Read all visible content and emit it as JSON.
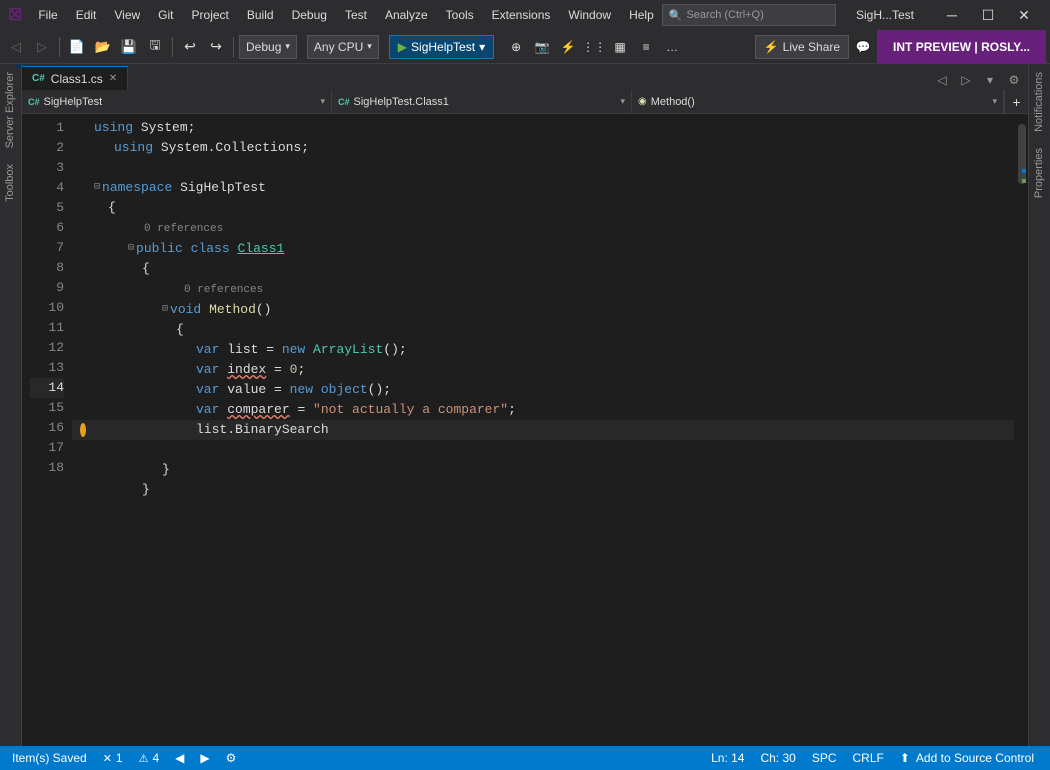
{
  "titleBar": {
    "logo": "☒",
    "menus": [
      "File",
      "Edit",
      "View",
      "Git",
      "Project",
      "Build",
      "Debug",
      "Test",
      "Analyze",
      "Tools",
      "Extensions",
      "Window",
      "Help"
    ],
    "searchPlaceholder": "Search (Ctrl+Q)",
    "windowTitle": "SigH...Test",
    "controls": [
      "─",
      "☐",
      "✕"
    ]
  },
  "toolbar": {
    "debugConfig": "Debug",
    "platform": "Any CPU",
    "runLabel": "▶ SigHelpTest",
    "liveShareLabel": "⚡ Live Share",
    "intPreviewLabel": "INT PREVIEW | ROSLY..."
  },
  "navBar": {
    "project": "SigHelpTest",
    "projectIcon": "C#",
    "file": "SigHelpTest.Class1",
    "fileIcon": "C#",
    "member": "◉ Method()",
    "addBtnLabel": "+"
  },
  "tabs": [
    {
      "label": "Class1.cs",
      "icon": "C#",
      "active": true,
      "dirty": false
    }
  ],
  "codeLines": [
    {
      "num": 1,
      "indent": 0,
      "hasFold": false,
      "isFoldOpen": false,
      "content": "<kw>using</kw> System;"
    },
    {
      "num": 2,
      "indent": 1,
      "hasFold": false,
      "isFoldOpen": false,
      "content": "<kw>using</kw> System.Collections;"
    },
    {
      "num": 3,
      "indent": 0,
      "hasFold": false,
      "isFoldOpen": false,
      "content": ""
    },
    {
      "num": 4,
      "indent": 0,
      "hasFold": true,
      "isFoldOpen": false,
      "content": "<kw>namespace</kw> SigHelpTest"
    },
    {
      "num": 5,
      "indent": 0,
      "hasFold": false,
      "isFoldOpen": false,
      "content": "{"
    },
    {
      "num": 6,
      "indent": 1,
      "hasFold": false,
      "isFoldOpen": false,
      "refHint": "0 references",
      "content": "<kw>public</kw> <kw>class</kw> <type>Class1</type>"
    },
    {
      "num": 7,
      "indent": 1,
      "hasFold": true,
      "isFoldOpen": false,
      "content": "{"
    },
    {
      "num": 8,
      "indent": 2,
      "hasFold": false,
      "isFoldOpen": false,
      "refHint": "0 references",
      "content": "<kw>void</kw> <method>Method</method>()"
    },
    {
      "num": 9,
      "indent": 2,
      "hasFold": true,
      "isFoldOpen": false,
      "content": "{"
    },
    {
      "num": 10,
      "indent": 3,
      "hasFold": false,
      "isFoldOpen": false,
      "content": "<kw>var</kw> list = <kw>new</kw> <type>ArrayList</type>();"
    },
    {
      "num": 11,
      "indent": 3,
      "hasFold": false,
      "isFoldOpen": false,
      "content": "<kw>var</kw> <under>index</under> = 0;"
    },
    {
      "num": 12,
      "indent": 3,
      "hasFold": false,
      "isFoldOpen": false,
      "content": "<kw>var</kw> value = <kw>new</kw> <kw>object</kw>();"
    },
    {
      "num": 13,
      "indent": 3,
      "hasFold": false,
      "isFoldOpen": false,
      "content": "<kw>var</kw> <under>comparer</under> = <string>\"not actually a comparer\"</string>;"
    },
    {
      "num": 14,
      "indent": 3,
      "hasFold": false,
      "isFoldOpen": false,
      "content": "list.BinarySearch"
    },
    {
      "num": 15,
      "indent": 2,
      "hasFold": false,
      "isFoldOpen": false,
      "content": ""
    },
    {
      "num": 16,
      "indent": 2,
      "hasFold": false,
      "isFoldOpen": false,
      "content": "}"
    },
    {
      "num": 17,
      "indent": 1,
      "hasFold": false,
      "isFoldOpen": false,
      "content": "}"
    },
    {
      "num": 18,
      "indent": 0,
      "hasFold": false,
      "isFoldOpen": false,
      "content": ""
    }
  ],
  "statusBar": {
    "savedText": "Item(s) Saved",
    "errors": "1",
    "warnings": "4",
    "prevNav": "◀",
    "nextNav": "▶",
    "lineInfo": "Ln: 14",
    "colInfo": "Ch: 30",
    "spacing": "SPC",
    "encoding": "CRLF",
    "addToSourceControl": "Add to Source Control",
    "sourceControlIcon": "⬆"
  }
}
